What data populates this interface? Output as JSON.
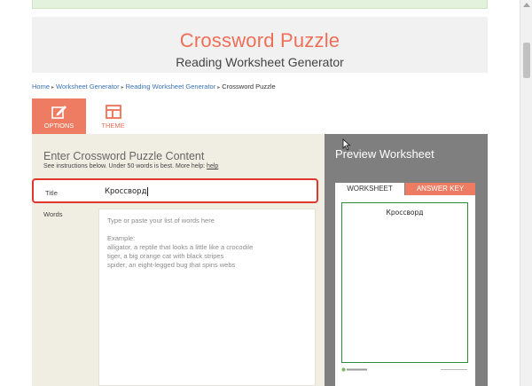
{
  "header": {
    "title": "Crossword Puzzle",
    "subtitle": "Reading Worksheet Generator"
  },
  "breadcrumb": {
    "items": [
      "Home",
      "Worksheet Generator",
      "Reading Worksheet Generator"
    ],
    "current": "Crossword Puzzle",
    "separator": "▸"
  },
  "tabs": {
    "options": "OPTIONS",
    "theme": "THEME"
  },
  "options_panel": {
    "heading": "Enter Crossword Puzzle Content",
    "instructions": "See instructions below. Under 50 words is best. More help: ",
    "help_link": "help",
    "title_label": "Title",
    "title_value": "Кроссворд",
    "words_label": "Words",
    "words_placeholder": {
      "line1": "Type or paste your list of words here",
      "line2": "Example:",
      "line3": "alligator, a reptile that looks a little like a crocodile",
      "line4": "tiger, a big orange cat with black stripes",
      "line5": "spider, an eight-legged bug that spins webs"
    }
  },
  "preview_panel": {
    "heading": "Preview Worksheet",
    "tab_worksheet": "WORKSHEET",
    "tab_answer_key": "ANSWER KEY",
    "worksheet_title": "Кроссворд"
  },
  "icons": {
    "options": "pencil-square-icon",
    "theme": "layout-grid-icon",
    "cursor": "mouse-pointer-icon"
  },
  "colors": {
    "accent": "#ee6f57",
    "tab_active": "#ee7c62",
    "highlight_border": "#e0382d",
    "panel_bg": "#f0ede3",
    "preview_bg": "#7f7f7f",
    "link": "#3a73b5",
    "worksheet_border": "#2e8b3e"
  }
}
